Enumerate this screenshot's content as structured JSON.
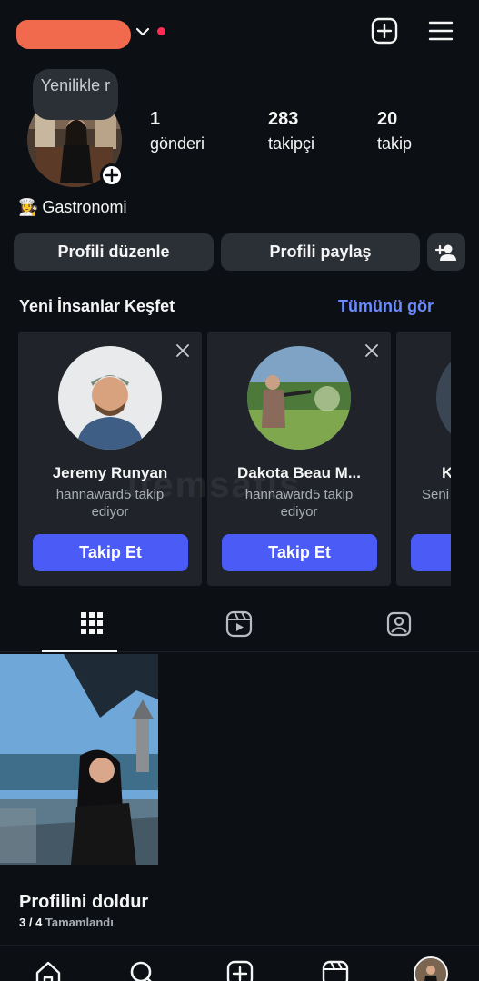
{
  "header": {
    "username_redacted": true,
    "icons": [
      "chevron-down-icon",
      "notification-dot",
      "new-post-icon",
      "menu-icon"
    ]
  },
  "profile": {
    "note": "Yenilikle r",
    "stats": [
      {
        "value": "1",
        "label": "gönderi"
      },
      {
        "value": "283",
        "label": "takipçi"
      },
      {
        "value": "20",
        "label": "takip"
      }
    ],
    "bio_emoji": "👩‍🍳",
    "bio": "Gastronomi"
  },
  "actions": {
    "edit": "Profili düzenle",
    "share": "Profili paylaş"
  },
  "discover": {
    "title": "Yeni İnsanlar Keşfet",
    "see_all": "Tümünü gör",
    "cards": [
      {
        "name": "Jeremy Runyan",
        "sub": "hannaward5 takip ediyor",
        "follow": "Takip Et"
      },
      {
        "name": "Dakota Beau M...",
        "sub": "hannaward5 takip ediyor",
        "follow": "Takip Et"
      },
      {
        "name": "K",
        "sub": "Seni",
        "follow": ""
      }
    ]
  },
  "complete": {
    "title": "Profilini doldur",
    "count": "3 / 4",
    "status": "Tamamlandı"
  },
  "colors": {
    "background": "#0c1014",
    "button": "#2b2f36",
    "accent": "#4a5cf5",
    "link": "#6b8cff"
  }
}
